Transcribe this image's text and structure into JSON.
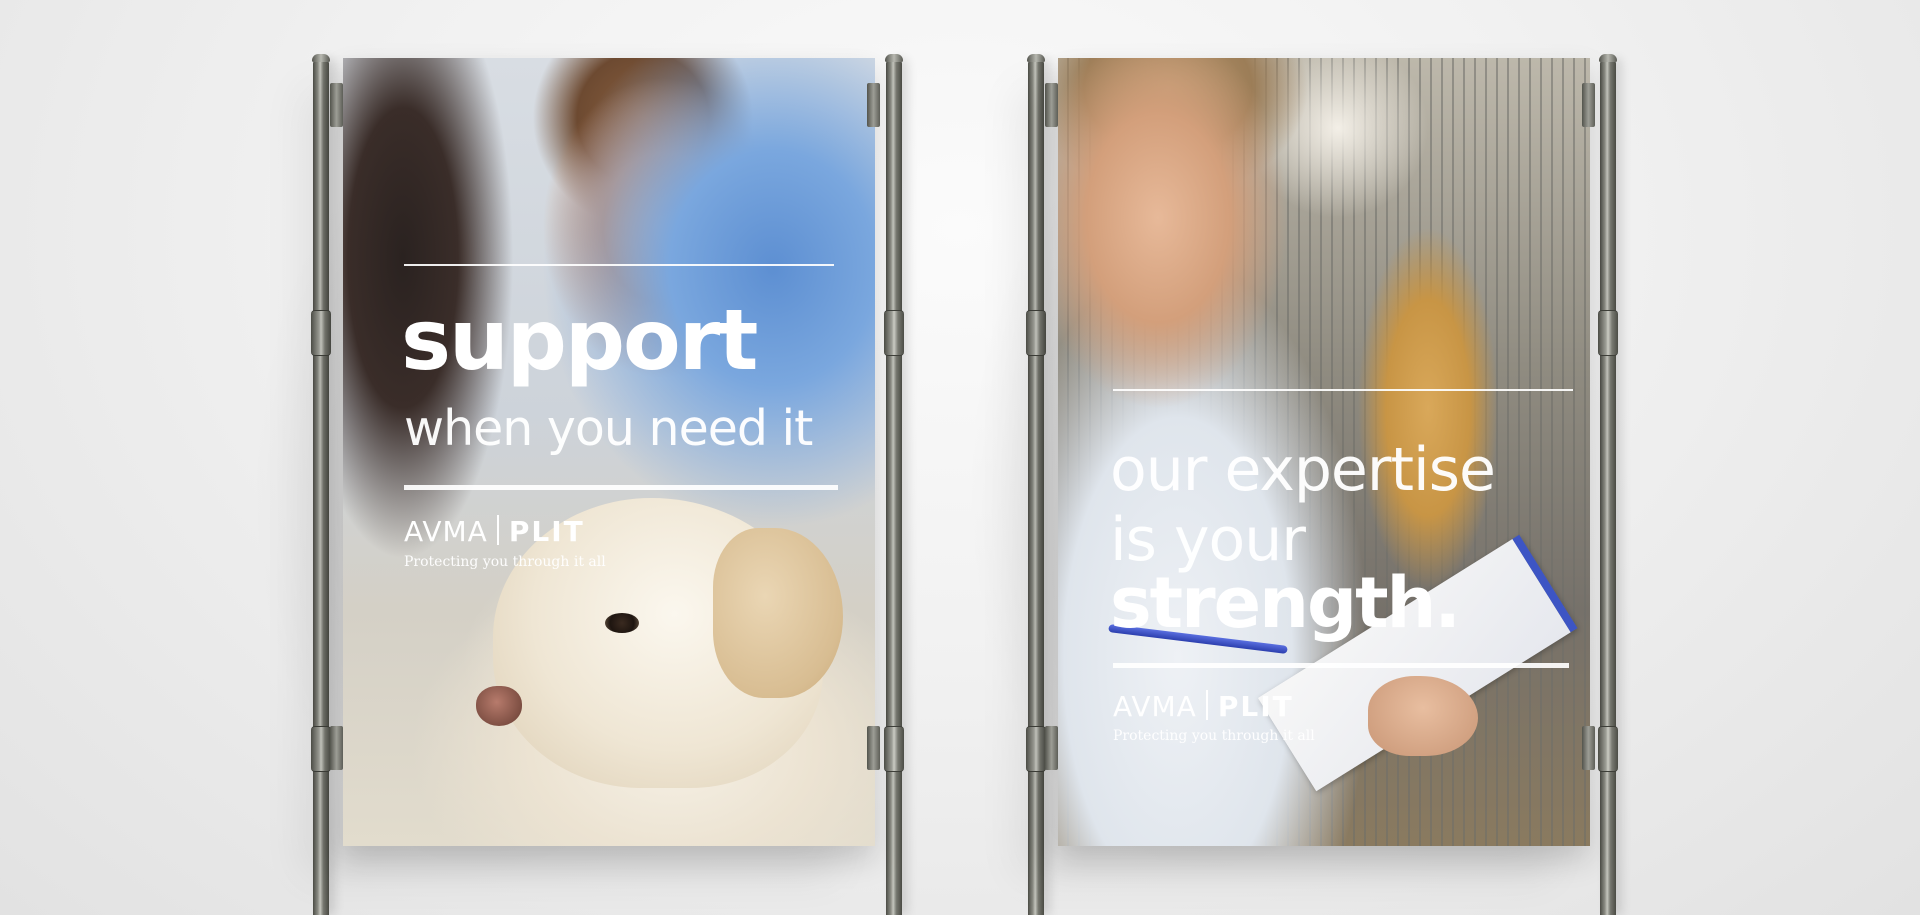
{
  "posters": [
    {
      "headline_bold": "support",
      "headline_light": "when you need it",
      "brand_left": "AVMA",
      "brand_right": "PLIT",
      "tagline": "Protecting you through it all"
    },
    {
      "headline_light_1": "our expertise",
      "headline_light_2": "is your",
      "headline_bold": "strength.",
      "brand_left": "AVMA",
      "brand_right": "PLIT",
      "tagline": "Protecting you through it all"
    }
  ],
  "colors": {
    "background": "#f1f1f1",
    "stand_metal": "#76776f",
    "text": "#ffffff",
    "scrub_blue": "#6f9fdc"
  }
}
